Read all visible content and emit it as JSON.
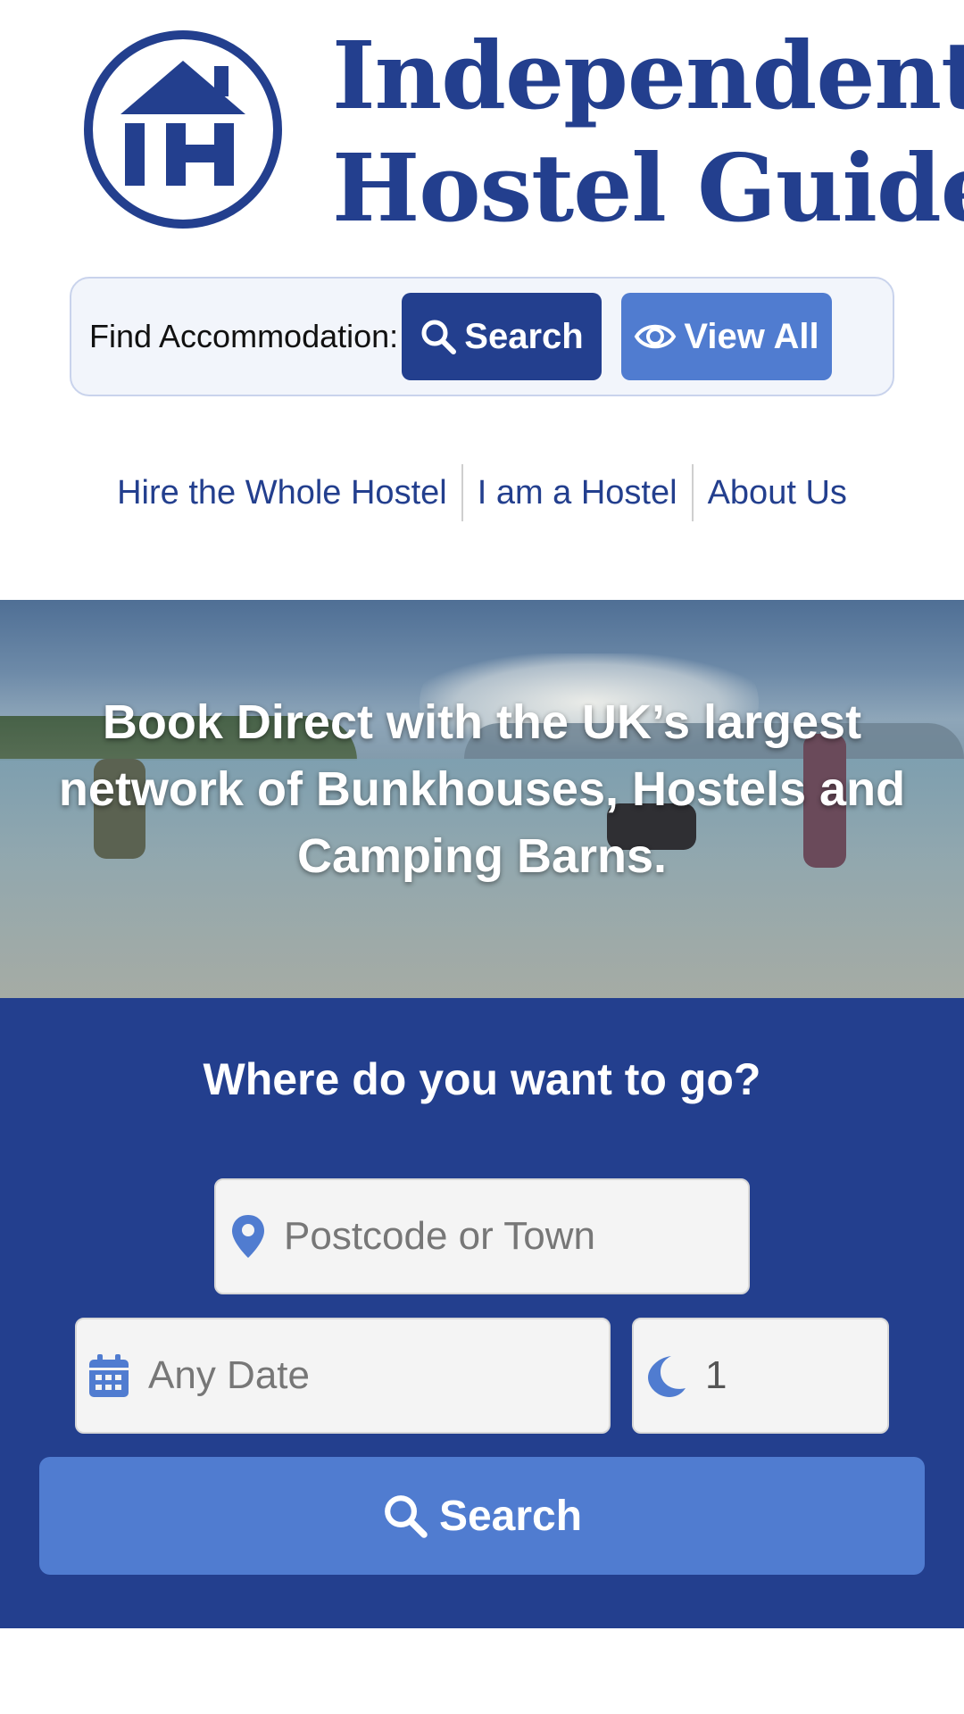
{
  "header": {
    "title_line1": "Independent",
    "title_line2": "Hostel Guide",
    "logo_letters": "IH",
    "brand_color": "#233f8e"
  },
  "find_bar": {
    "label": "Find Accommodation:",
    "search_label": "Search",
    "view_all_label": "View All"
  },
  "nav": {
    "items": [
      {
        "label": "Hire the Whole Hostel"
      },
      {
        "label": "I am a Hostel"
      },
      {
        "label": "About Us"
      }
    ]
  },
  "hero": {
    "headline": "Book Direct with the UK’s largest network of Bunkhouses, Hostels and Camping Barns."
  },
  "search_panel": {
    "title": "Where do you want to go?",
    "location_placeholder": "Postcode or Town",
    "date_placeholder": "Any Date",
    "nights_value": "1",
    "search_label": "Search",
    "panel_color": "#233f8e",
    "accent_color": "#507cd0"
  },
  "icons": {
    "search": "magnifier-icon",
    "view_all": "eye-icon",
    "location": "map-pin-icon",
    "date": "calendar-icon",
    "nights": "moon-icon"
  }
}
